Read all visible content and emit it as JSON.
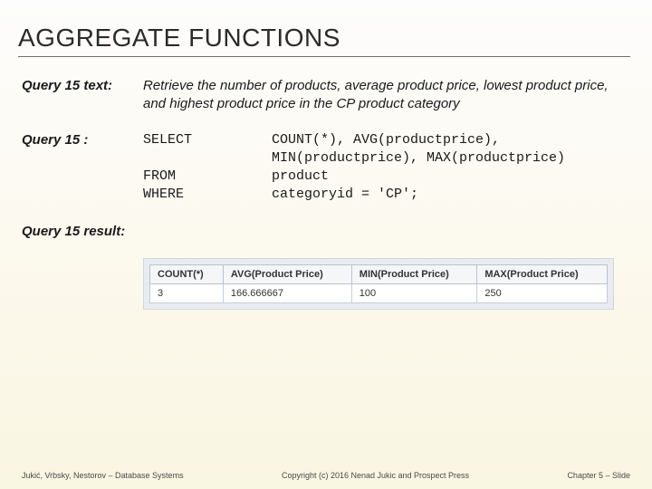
{
  "title": "AGGREGATE FUNCTIONS",
  "q_text_label": "Query 15 text:",
  "q_text_body": "Retrieve the number of products, average product price, lowest product price, and highest product price in the CP product category",
  "q_label": "Query 15 :",
  "sql": {
    "kw1": "SELECT",
    "kw2": "FROM",
    "kw3": "WHERE",
    "arg1a": "COUNT(*), AVG(productprice),",
    "arg1b": "MIN(productprice), MAX(productprice)",
    "arg2": "product",
    "arg3": "categoryid = 'CP';"
  },
  "result_label": "Query 15 result:",
  "chart_data": {
    "type": "table",
    "headers": [
      "COUNT(*)",
      "AVG(Product Price)",
      "MIN(Product Price)",
      "MAX(Product Price)"
    ],
    "rows": [
      [
        "3",
        "166.666667",
        "100",
        "250"
      ]
    ]
  },
  "footer": {
    "left": "Jukić, Vrbsky, Nestorov – Database Systems",
    "center": "Copyright (c) 2016 Nenad Jukic and Prospect Press",
    "right": "Chapter 5 – Slide"
  }
}
